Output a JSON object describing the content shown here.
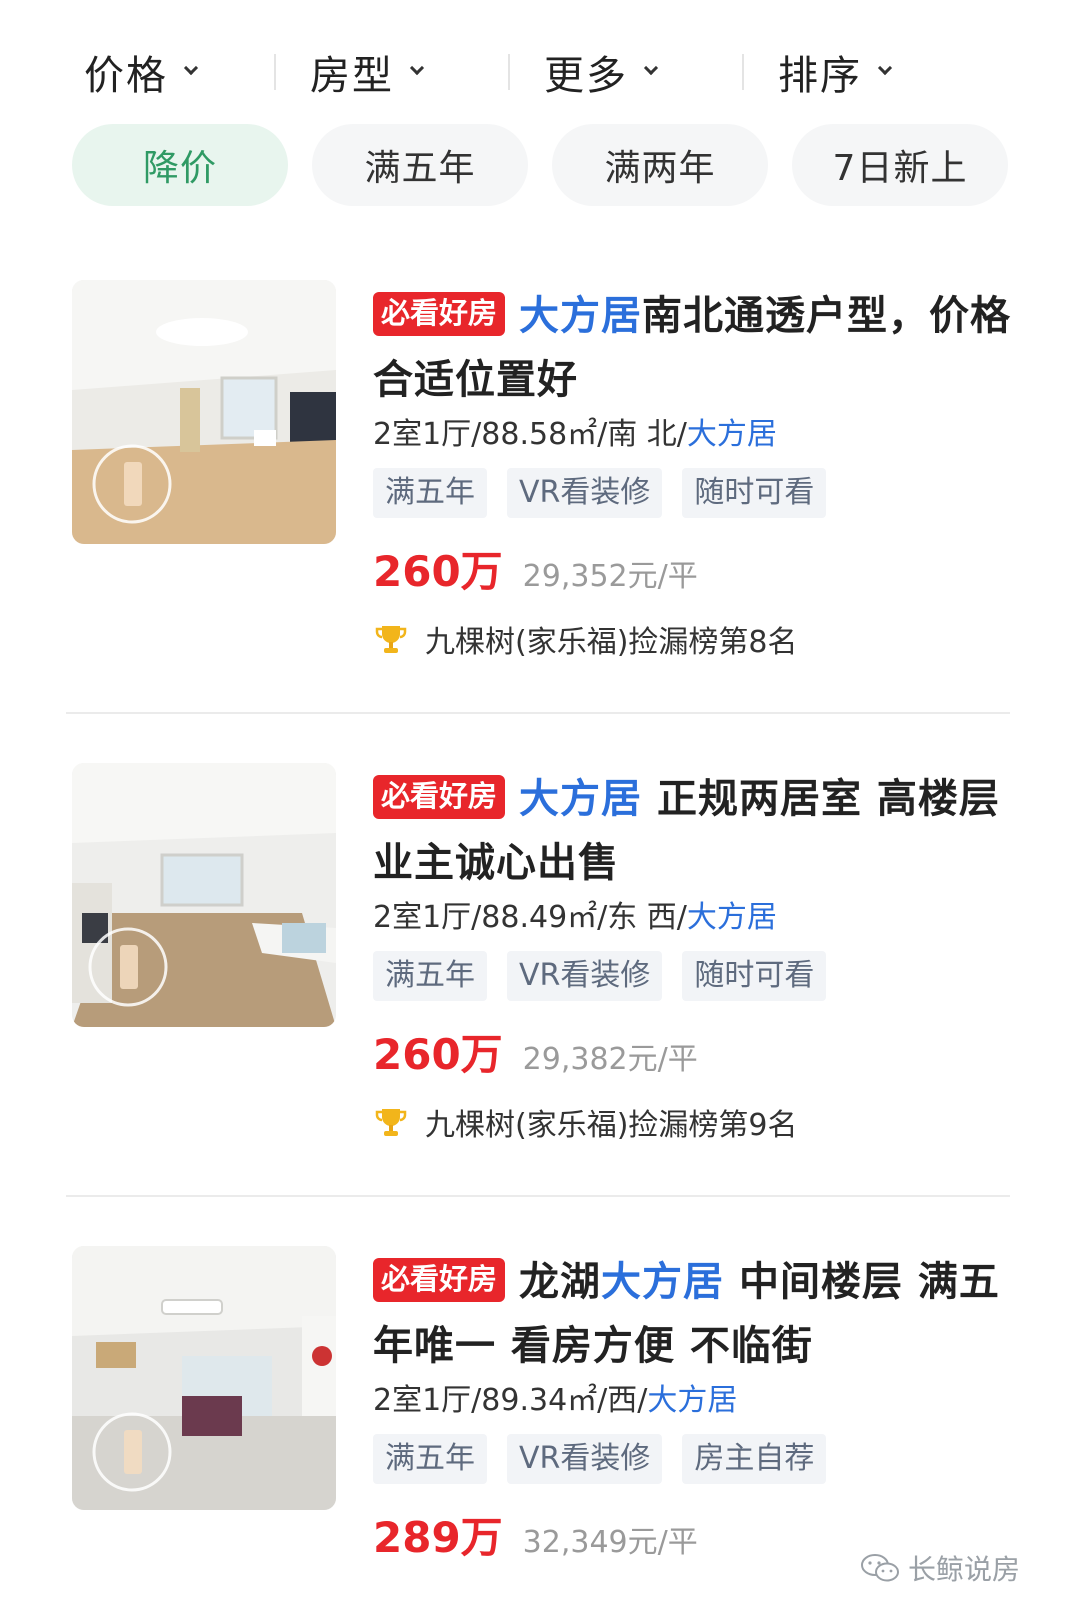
{
  "filters": {
    "items": [
      {
        "label": "价格"
      },
      {
        "label": "房型"
      },
      {
        "label": "更多"
      },
      {
        "label": "排序"
      }
    ]
  },
  "quick_filters": [
    {
      "label": "降价",
      "active": true
    },
    {
      "label": "满五年",
      "active": false
    },
    {
      "label": "满两年",
      "active": false
    },
    {
      "label": "7日新上",
      "active": false
    }
  ],
  "listings": [
    {
      "badge": "必看好房",
      "title_highlight": "大方居",
      "title_rest": "南北通透户型，价格合适位置好",
      "meta_prefix": "2室1厅/88.58㎡/南 北/",
      "meta_community": "大方居",
      "tags": [
        "满五年",
        "VR看装修",
        "随时可看"
      ],
      "price": "260万",
      "unit_price": "29,352元/平",
      "rank": "九棵树(家乐福)捡漏榜第8名"
    },
    {
      "badge": "必看好房",
      "title_highlight": "大方居",
      "title_rest": " 正规两居室  高楼层  业主诚心出售",
      "meta_prefix": "2室1厅/88.49㎡/东 西/",
      "meta_community": "大方居",
      "tags": [
        "满五年",
        "VR看装修",
        "随时可看"
      ],
      "price": "260万",
      "unit_price": "29,382元/平",
      "rank": "九棵树(家乐福)捡漏榜第9名"
    },
    {
      "badge": "必看好房",
      "title_prefix": "龙湖",
      "title_highlight": "大方居",
      "title_rest": " 中间楼层 满五年唯一 看房方便 不临街",
      "meta_prefix": "2室1厅/89.34㎡/西/",
      "meta_community": "大方居",
      "tags": [
        "满五年",
        "VR看装修",
        "房主自荐"
      ],
      "price": "289万",
      "unit_price": "32,349元/平"
    }
  ],
  "watermark": "长鲸说房",
  "colors": {
    "accent_red": "#e8262b",
    "link_blue": "#2b6fdb",
    "active_green": "#2f9a64"
  }
}
